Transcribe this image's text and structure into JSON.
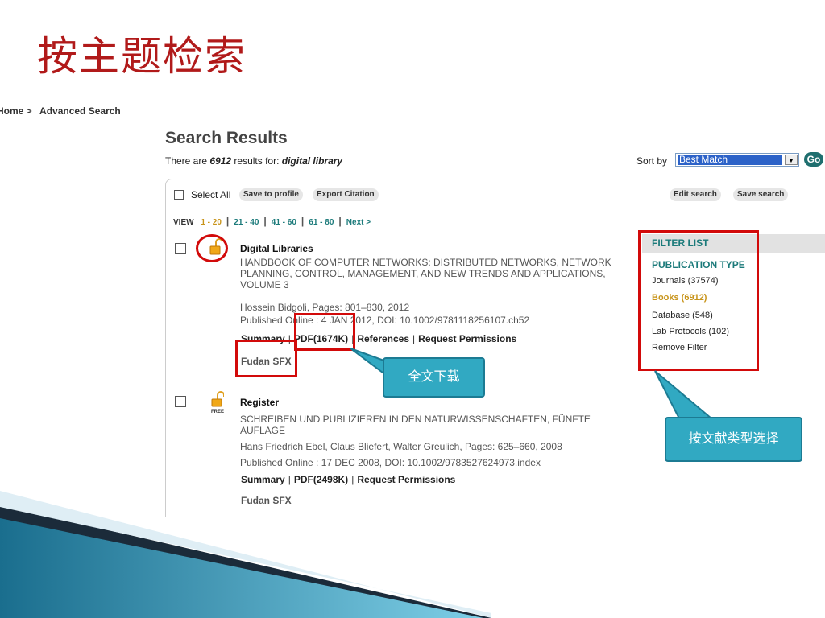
{
  "slide": {
    "title": "按主题检索"
  },
  "breadcrumb": {
    "home": "Home >",
    "current": "Advanced Search"
  },
  "results": {
    "title": "Search Results",
    "summary_prefix": "There are ",
    "count": "6912",
    "summary_mid": " results for: ",
    "query": "digital library"
  },
  "sort": {
    "label": "Sort by",
    "selected": "Best Match",
    "go": "Go"
  },
  "toolbar": {
    "select_all": "Select All",
    "save_profile": "Save to profile",
    "export_citation": "Export Citation",
    "edit_search": "Edit search",
    "save_search": "Save search"
  },
  "pager": {
    "view_label": "VIEW",
    "pages": [
      "1 - 20",
      "21 - 40",
      "41 - 60",
      "61 - 80"
    ],
    "next": "Next >"
  },
  "entries": [
    {
      "title": "Digital Libraries",
      "source_lines": [
        "HANDBOOK OF COMPUTER NETWORKS: DISTRIBUTED NETWORKS, NETWORK",
        "PLANNING, CONTROL, MANAGEMENT, AND NEW TRENDS AND APPLICATIONS,",
        "VOLUME 3"
      ],
      "authors": "Hossein Bidgoli, Pages: 801–830, 2012",
      "published": "Published Online : 4 JAN 2012, DOI: 10.1002/9781118256107.ch52",
      "links": [
        "Summary",
        "PDF(1674K)",
        "References",
        "Request Permissions"
      ],
      "sfx": "Fudan SFX"
    },
    {
      "title": "Register",
      "badge": "FREE",
      "source_lines": [
        "SCHREIBEN UND PUBLIZIEREN IN DEN NATURWISSENSCHAFTEN, FÜNFTE",
        "AUFLAGE"
      ],
      "authors": "Hans Friedrich Ebel, Claus Bliefert, Walter Greulich, Pages: 625–660, 2008",
      "published": "Published Online : 17 DEC 2008, DOI: 10.1002/9783527624973.index",
      "links": [
        "Summary",
        "PDF(2498K)",
        "Request Permissions"
      ],
      "sfx": "Fudan SFX"
    }
  ],
  "filter": {
    "header": "FILTER LIST",
    "type_label": "PUBLICATION TYPE",
    "items": [
      "Journals (37574)",
      "Books (6912)",
      "Database (548)",
      "Lab Protocols (102)",
      "Remove Filter"
    ]
  },
  "callouts": {
    "download": "全文下载",
    "filter_by_type": "按文献类型选择"
  },
  "colors": {
    "title_red": "#b11a1a",
    "highlight_red": "#d20a0a",
    "callout_blue": "#31a9c2",
    "link_teal": "#1b7a7a",
    "active_gold": "#c8941a"
  }
}
